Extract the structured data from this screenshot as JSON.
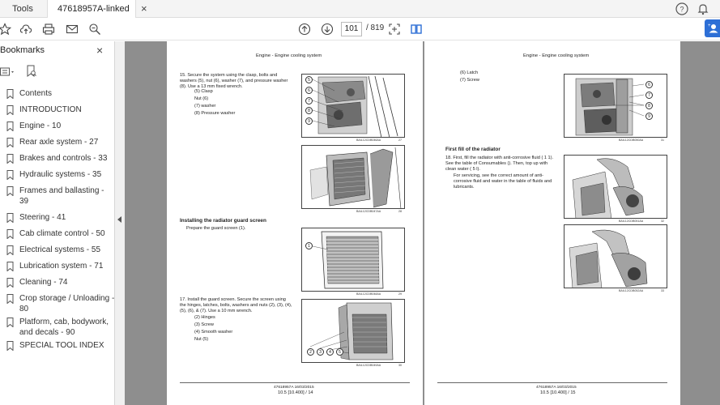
{
  "tabs": {
    "tools": "Tools",
    "document": "47618957A-linked p...",
    "close": "×"
  },
  "toolbar": {
    "current_page": "101",
    "total_pages": "/ 819"
  },
  "sidebar": {
    "title": "Bookmarks",
    "close": "×",
    "items": [
      {
        "label": "Contents"
      },
      {
        "label": "INTRODUCTION"
      },
      {
        "label": "Engine - 10"
      },
      {
        "label": "Rear axle system - 27"
      },
      {
        "label": "Brakes and controls - 33"
      },
      {
        "label": "Hydraulic systems - 35"
      },
      {
        "label": "Frames and ballasting - 39"
      },
      {
        "label": "Steering - 41"
      },
      {
        "label": "Cab climate control - 50"
      },
      {
        "label": "Electrical systems - 55"
      },
      {
        "label": "Lubrication system - 71"
      },
      {
        "label": "Cleaning - 74"
      },
      {
        "label": "Crop storage / Unloading - 80"
      },
      {
        "label": "Platform, cab, bodywork, and decals - 90"
      },
      {
        "label": "SPECIAL TOOL INDEX"
      }
    ]
  },
  "left_page": {
    "header": "Engine - Engine cooling system",
    "step15": "15.   Secure the system using the clasp, bolts and washers (5), nut (6), washer (7), and pressure washer (8). Use a 13 mm fixed wrench.",
    "list15": [
      "(5) Clasp",
      "Nut (6)",
      "(7) washer",
      "(8) Pressure washer"
    ],
    "fig27_code": "BAIL12CDB046AA",
    "fig27_num": "27",
    "fig28_code": "BAIL12CDB047AA",
    "fig28_num": "28",
    "section_title": "Installing the radiator guard screen",
    "prepare": "Prepare the guard screen (1).",
    "fig29_code": "BAIL12CDB048AA",
    "fig29_num": "29",
    "step17": "17.   Install the guard screen. Secure the screen using the hinges, latches, bolts, washers and nuts (2), (3), (4), (5), (6), & (7). Use a 10 mm wrench.",
    "list17": [
      "(2) Hinges",
      "(3) Screw",
      "(4) Smooth washer",
      "Nut (5)"
    ],
    "fig30_code": "BAIL12CDB049AA",
    "fig30_num": "30",
    "callouts27": [
      "5",
      "6",
      "7",
      "8",
      "9"
    ],
    "callouts29": [
      "1"
    ],
    "callouts30": [
      "2",
      "3",
      "4",
      "5"
    ],
    "footer_a": "47618957A 16/03/2015",
    "footer_b": "10.5 [10.400] / 14"
  },
  "right_page": {
    "header": "Engine - Engine cooling system",
    "list_top": [
      "(6) Latch",
      "(7) Screw"
    ],
    "fig31_code": "BAIL12CDB050AA",
    "fig31_num": "31",
    "callouts31": [
      "6",
      "7",
      "8",
      "9"
    ],
    "section_title": "First fill of the radiator",
    "step18": "18.   First, fill the radiator with anti-corrosive fluid ( 1 1). See the table of Consumables (). Then, top up with clean water ( 5 l).",
    "step18b": "For servicing, see the correct amount of anti-corrosive fluid and water in the table of fluids and lubricants.",
    "fig32_code": "BAIL12CDB051AA",
    "fig32_num": "32",
    "fig33_code": "BAIL12CDB052AA",
    "fig33_num": "33",
    "footer_a": "47618957A 16/03/2015",
    "footer_b": "10.5 [10.400] / 15"
  },
  "colors": {
    "doc_background": "#8e8e8e",
    "accent": "#2d6fd6"
  }
}
